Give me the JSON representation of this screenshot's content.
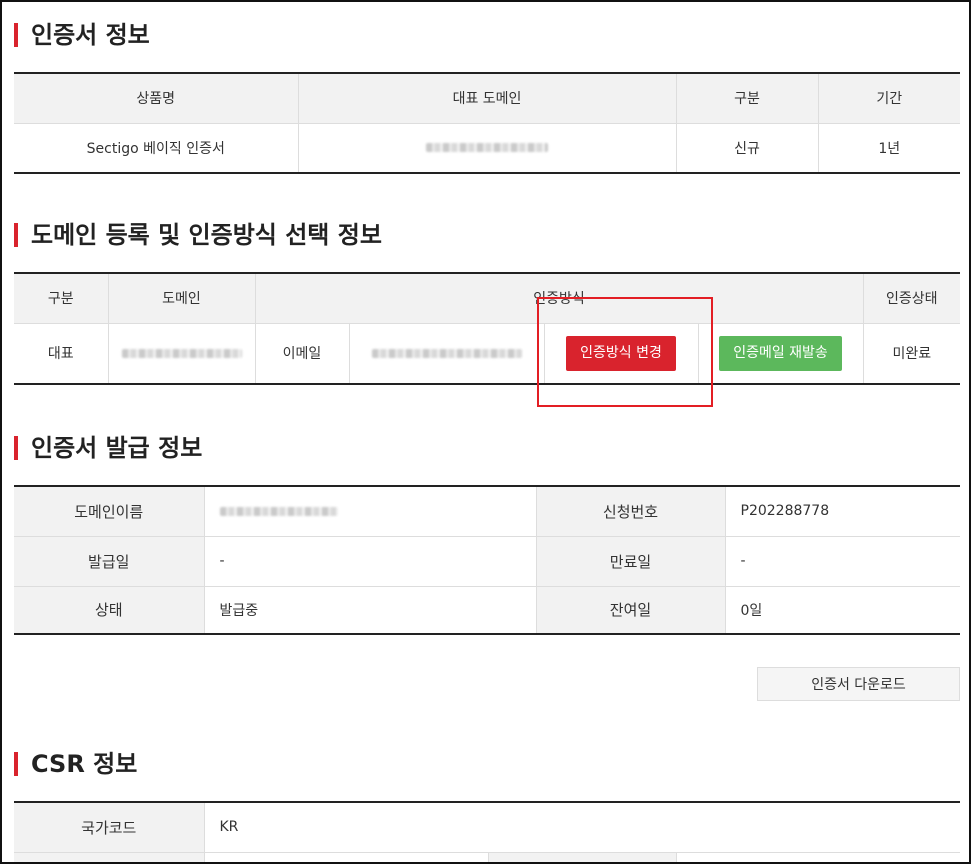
{
  "sections": {
    "cert_info": {
      "title": "인증서 정보",
      "headers": [
        "상품명",
        "대표 도메인",
        "구분",
        "기간"
      ],
      "row": {
        "product": "Sectigo 베이직 인증서",
        "type": "신규",
        "period": "1년"
      }
    },
    "domain_auth": {
      "title": "도메인 등록 및 인증방식 선택 정보",
      "headers": {
        "type": "구분",
        "domain": "도메인",
        "auth_method": "인증방식",
        "auth_status": "인증상태"
      },
      "row": {
        "type": "대표",
        "method": "이메일",
        "change_button": "인증방식 변경",
        "resend_button": "인증메일 재발송",
        "status": "미완료"
      }
    },
    "issue_info": {
      "title": "인증서 발급 정보",
      "labels": {
        "domain_name": "도메인이름",
        "request_no": "신청번호",
        "issue_date": "발급일",
        "expiry_date": "만료일",
        "status": "상태",
        "remaining": "잔여일"
      },
      "values": {
        "request_no": "P202288778",
        "issue_date": "-",
        "expiry_date": "-",
        "status": "발급중",
        "remaining": "0일"
      },
      "download_button": "인증서 다운로드"
    },
    "csr_info": {
      "title": "CSR 정보",
      "labels": {
        "country_code": "국가코드"
      },
      "values": {
        "country_code": "KR"
      }
    }
  },
  "colors": {
    "accent": "#d9232d",
    "green": "#5cb85c",
    "highlight": "#e31e24",
    "header_bg": "#f2f2f2"
  }
}
